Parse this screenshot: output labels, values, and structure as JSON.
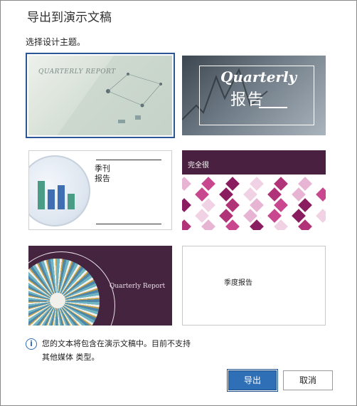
{
  "dialog": {
    "title": "导出到演示文稿",
    "subtitle": "选择设计主题。"
  },
  "themes": [
    {
      "id": "theme-1",
      "text": "QUARTERLY REPORT",
      "selected": true
    },
    {
      "id": "theme-2",
      "text_en": "Quarterly",
      "text_cn": "报告",
      "selected": false
    },
    {
      "id": "theme-3",
      "text_line1": "季刊",
      "text_line2": "报告",
      "selected": false
    },
    {
      "id": "theme-4",
      "text": "完全很",
      "selected": false
    },
    {
      "id": "theme-5",
      "text": "Quarterly Report",
      "selected": false
    },
    {
      "id": "theme-6",
      "text": "季度报告",
      "selected": false
    }
  ],
  "info": {
    "icon": "info-icon",
    "line1": "您的文本将包含在演示文稿中。目前不支持",
    "line2": "其他媒体 类型。"
  },
  "buttons": {
    "export": "导出",
    "cancel": "取消"
  },
  "colors": {
    "accent": "#2f6fb6",
    "theme4_band": "#4a2040",
    "theme5_bg": "#45243f"
  }
}
